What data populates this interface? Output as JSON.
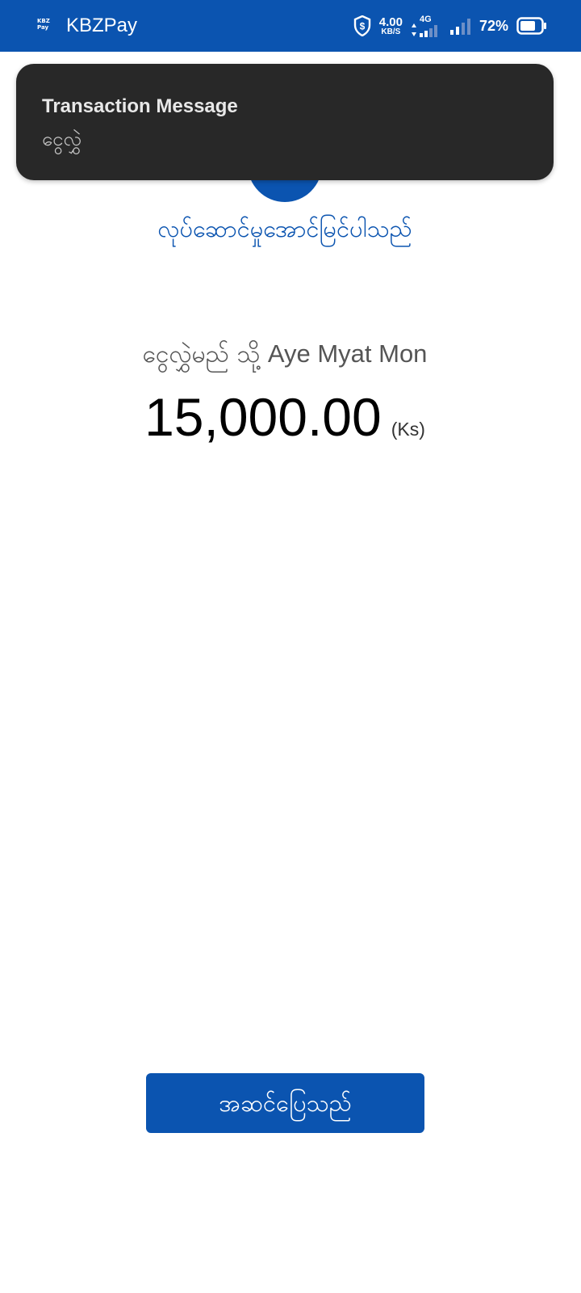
{
  "status_bar": {
    "app_name": "KBZPay",
    "app_icon_line1": "KBZ",
    "app_icon_line2": "Pay",
    "net_speed_value": "4.00",
    "net_speed_unit": "KB/S",
    "network_type": "4G",
    "battery_percent": "72%",
    "background_color": "#0b54b0",
    "icons": [
      "kbzpay-app-icon",
      "shield-icon",
      "data-arrows-icon",
      "signal-icon",
      "battery-icon"
    ]
  },
  "toast": {
    "title": "Transaction Message",
    "body": "ငွေလွှဲ",
    "background_color": "#282828"
  },
  "result": {
    "success_message": "လုပ်ဆောင်မှုအောင်မြင်ပါသည်",
    "recipient_prefix": "ငွေလွှဲမည် သို့",
    "recipient_name": "Aye Myat Mon",
    "amount": "15,000.00",
    "currency": "(Ks)",
    "accent_color": "#0b54b0"
  },
  "actions": {
    "done_label": "အဆင်ပြေသည်"
  }
}
